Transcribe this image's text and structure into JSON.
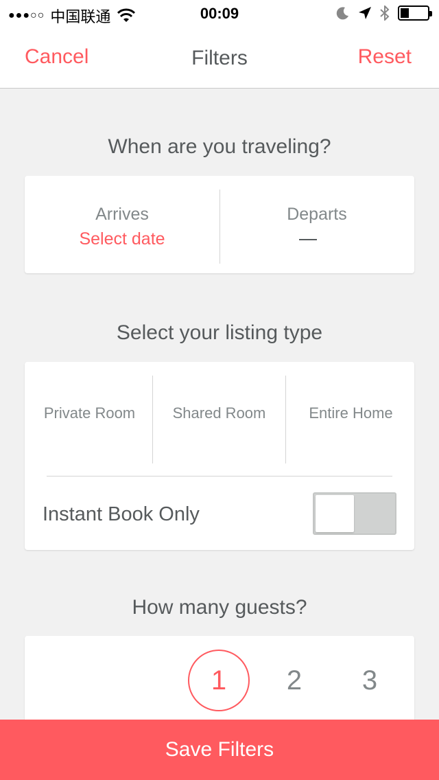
{
  "status_bar": {
    "signal_dots": "●●●○○",
    "carrier": "中国联通",
    "time": "00:09",
    "icons": [
      "wifi-icon",
      "moon-icon",
      "location-arrow-icon",
      "bluetooth-icon",
      "battery-icon"
    ]
  },
  "nav": {
    "cancel_label": "Cancel",
    "title": "Filters",
    "reset_label": "Reset"
  },
  "travel": {
    "heading": "When are you traveling?",
    "arrives_label": "Arrives",
    "arrives_value": "Select date",
    "departs_label": "Departs"
  },
  "listing": {
    "heading": "Select your listing type",
    "types": [
      "Private Room",
      "Shared Room",
      "Entire Home"
    ],
    "instant_book_label": "Instant Book Only",
    "instant_book_on": false
  },
  "guests": {
    "heading": "How many guests?",
    "options": [
      "1",
      "2",
      "3"
    ],
    "selected": "1"
  },
  "footer": {
    "save_label": "Save Filters"
  },
  "colors": {
    "accent": "#ff5a5f",
    "text": "#565a5c",
    "muted": "#82888a",
    "background": "#f1f1f1"
  }
}
